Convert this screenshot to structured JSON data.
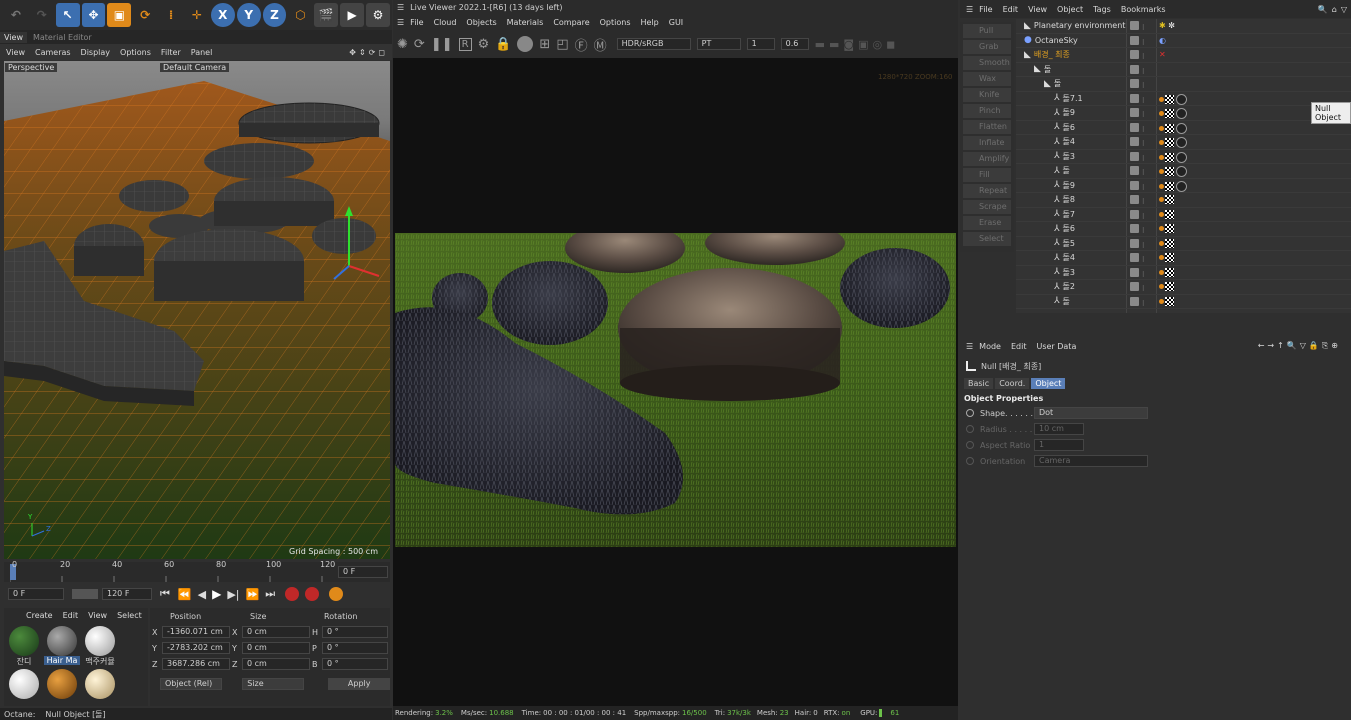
{
  "viewport": {
    "tabs": [
      "View",
      "Material Editor"
    ],
    "menu": [
      "View",
      "Cameras",
      "Display",
      "Options",
      "Filter",
      "Panel"
    ],
    "label": "Perspective",
    "camera": "Default Camera",
    "grid_spacing": "Grid Spacing : 500 cm",
    "axis_y": "Y",
    "axis_z": "Z"
  },
  "timeline": {
    "ticks": [
      "0",
      "20",
      "40",
      "60",
      "80",
      "100",
      "120"
    ],
    "current": "0 F",
    "start": "0 F",
    "end": "120 F"
  },
  "materials": {
    "menu": [
      "Create",
      "Edit",
      "View",
      "Select"
    ],
    "items": [
      "잔디",
      "Hair Ma",
      "맥주커뮬",
      "",
      "",
      ""
    ]
  },
  "coords": {
    "headers": [
      "Position",
      "Size",
      "Rotation"
    ],
    "rows": [
      {
        "axis": "X",
        "pos": "-1360.071 cm",
        "saxis": "X",
        "size": "0 cm",
        "raxis": "H",
        "rot": "0 °"
      },
      {
        "axis": "Y",
        "pos": "-2783.202 cm",
        "saxis": "Y",
        "size": "0 cm",
        "raxis": "P",
        "rot": "0 °"
      },
      {
        "axis": "Z",
        "pos": "3687.286 cm",
        "saxis": "Z",
        "size": "0 cm",
        "raxis": "B",
        "rot": "0 °"
      }
    ],
    "mode": "Object (Rel)",
    "size_mode": "Size",
    "apply": "Apply"
  },
  "statusbar": {
    "octane": "Octane:",
    "object": "Null Object [돌]"
  },
  "live_viewer": {
    "title": "Live Viewer 2022.1-[R6] (13 days left)",
    "menu": [
      "File",
      "Cloud",
      "Objects",
      "Materials",
      "Compare",
      "Options",
      "Help",
      "GUI"
    ],
    "color_space": "HDR/sRGB",
    "kernel": "PT",
    "val1": "1",
    "val2": "0.6",
    "overlay": "1280*720 ZOOM:160",
    "status": {
      "rendering_label": "Rendering:",
      "rendering": "3.2%",
      "msec_label": "Ms/sec:",
      "msec": "10.688",
      "time_label": "Time:",
      "time": "00 : 00 : 01/00 : 00 : 41",
      "spp_label": "Spp/maxspp:",
      "spp": "16/500",
      "tri_label": "Tri:",
      "tri": "37k/3k",
      "mesh_label": "Mesh:",
      "mesh": "23",
      "hair_label": "Hair:",
      "hair": "0",
      "rtx_label": "RTX:",
      "rtx": "on",
      "gpu_label": "GPU:",
      "gpu": "61"
    }
  },
  "sculpt_tools": [
    "Pull",
    "Grab",
    "Smooth",
    "Wax",
    "Knife",
    "Pinch",
    "Flatten",
    "Inflate",
    "Amplify",
    "Fill",
    "Repeat",
    "Scrape",
    "Erase",
    "Select"
  ],
  "object_manager": {
    "menu": [
      "File",
      "Edit",
      "View",
      "Object",
      "Tags",
      "Bookmarks"
    ],
    "tooltip": "Null Object",
    "objects": [
      {
        "name": "Planetary environment",
        "indent": 0,
        "color": "#d8d8d8"
      },
      {
        "name": "OctaneSky",
        "indent": 0,
        "color": "#d8d8d8"
      },
      {
        "name": "배경_ 최종",
        "indent": 0,
        "color": "#e0a020"
      },
      {
        "name": "돌",
        "indent": 1,
        "color": "#d8d8d8"
      },
      {
        "name": "돌",
        "indent": 2,
        "color": "#d8d8d8"
      },
      {
        "name": "돌7.1",
        "indent": 3,
        "color": "#d8d8d8"
      },
      {
        "name": "돌9",
        "indent": 3,
        "color": "#d8d8d8"
      },
      {
        "name": "돌6",
        "indent": 3,
        "color": "#d8d8d8"
      },
      {
        "name": "돌4",
        "indent": 3,
        "color": "#d8d8d8"
      },
      {
        "name": "돌3",
        "indent": 3,
        "color": "#d8d8d8"
      },
      {
        "name": "돌",
        "indent": 3,
        "color": "#d8d8d8"
      },
      {
        "name": "돌9",
        "indent": 3,
        "color": "#d8d8d8"
      },
      {
        "name": "돌8",
        "indent": 3,
        "color": "#d8d8d8"
      },
      {
        "name": "돌7",
        "indent": 3,
        "color": "#d8d8d8"
      },
      {
        "name": "돌6",
        "indent": 3,
        "color": "#d8d8d8"
      },
      {
        "name": "돌5",
        "indent": 3,
        "color": "#d8d8d8"
      },
      {
        "name": "돌4",
        "indent": 3,
        "color": "#d8d8d8"
      },
      {
        "name": "돌3",
        "indent": 3,
        "color": "#d8d8d8"
      },
      {
        "name": "돌2",
        "indent": 3,
        "color": "#d8d8d8"
      },
      {
        "name": "돌",
        "indent": 3,
        "color": "#d8d8d8"
      }
    ]
  },
  "attributes": {
    "menu": [
      "Mode",
      "Edit",
      "User Data"
    ],
    "object_title": "Null [배경_ 최종]",
    "tabs": [
      "Basic",
      "Coord.",
      "Object"
    ],
    "section": "Object Properties",
    "props": [
      {
        "label": "Shape. . . . . .",
        "value": "Dot",
        "enabled": true
      },
      {
        "label": "Radius . . . . .",
        "value": "10 cm",
        "enabled": false
      },
      {
        "label": "Aspect Ratio",
        "value": "1",
        "enabled": false
      },
      {
        "label": "Orientation",
        "value": "Camera",
        "enabled": false
      }
    ]
  }
}
